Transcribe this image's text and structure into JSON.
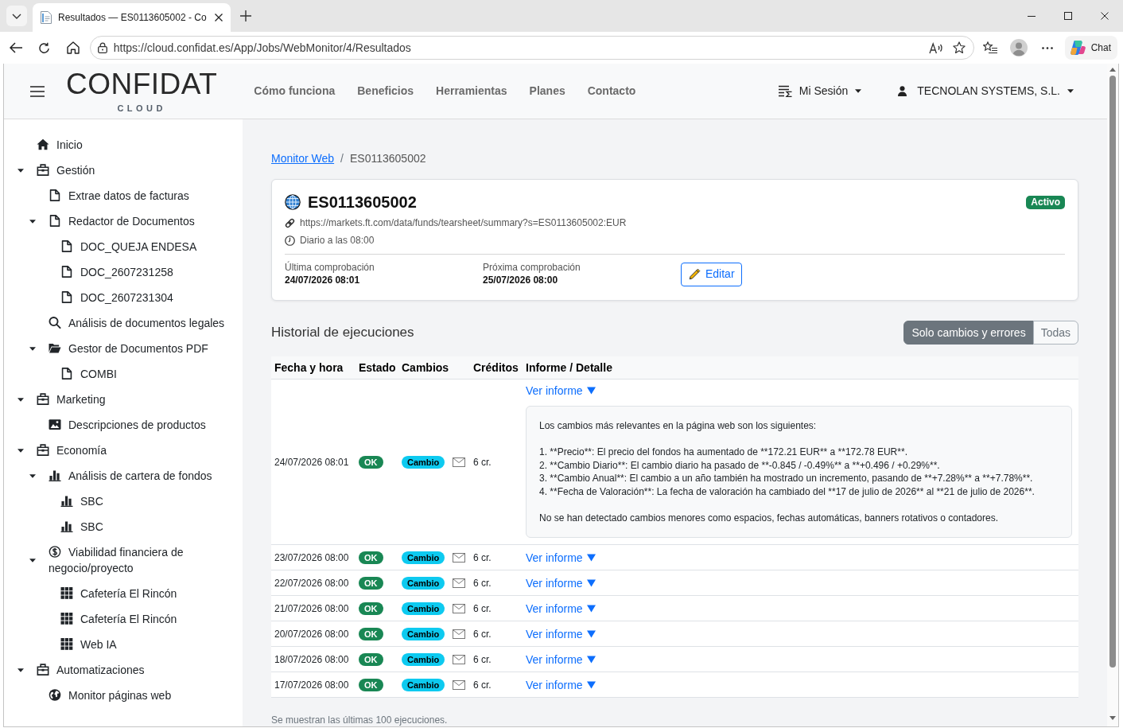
{
  "browser": {
    "tab_title": "Resultados — ES0113605002 - Co",
    "url": "https://cloud.confidat.es/App/Jobs/WebMonitor/4/Resultados",
    "chat_button": "Chat"
  },
  "navbar": {
    "logo": "CONFIDAT",
    "logo_subtitle": "CLOUD",
    "links": [
      "Cómo funciona",
      "Beneficios",
      "Herramientas",
      "Planes",
      "Contacto"
    ],
    "session_menu": "Mi Sesión",
    "account_menu": "TECNOLAN SYSTEMS, S.L."
  },
  "sidebar": {
    "items": [
      {
        "label": "Inicio",
        "kind": "home"
      },
      {
        "label": "Gestión",
        "kind": "toolbox",
        "expanded": true,
        "children": [
          {
            "label": "Extrae datos de facturas",
            "kind": "document"
          },
          {
            "label": "Redactor de Documentos",
            "kind": "document",
            "expanded": true,
            "children": [
              {
                "label": "DOC_QUEJA ENDESA",
                "kind": "document"
              },
              {
                "label": "DOC_2607231258",
                "kind": "document"
              },
              {
                "label": "DOC_2607231304",
                "kind": "document"
              }
            ]
          },
          {
            "label": "Análisis de documentos legales",
            "kind": "search"
          },
          {
            "label": "Gestor de Documentos PDF",
            "kind": "folder",
            "expanded": true,
            "children": [
              {
                "label": "COMBI",
                "kind": "document"
              }
            ]
          }
        ]
      },
      {
        "label": "Marketing",
        "kind": "toolbox",
        "expanded": true,
        "children": [
          {
            "label": "Descripciones de productos",
            "kind": "image"
          }
        ]
      },
      {
        "label": "Economía",
        "kind": "toolbox",
        "expanded": true,
        "children": [
          {
            "label": "Análisis de cartera de fondos",
            "kind": "chart",
            "expanded": true,
            "children": [
              {
                "label": "SBC",
                "kind": "chart"
              },
              {
                "label": "SBC",
                "kind": "chart"
              }
            ]
          },
          {
            "label": "Viabilidad financiera de negocio/proyecto",
            "kind": "dollar",
            "expanded": true,
            "children": [
              {
                "label": "Cafetería El Rincón",
                "kind": "grid"
              },
              {
                "label": "Cafetería El Rincón",
                "kind": "grid"
              },
              {
                "label": "Web IA",
                "kind": "grid"
              }
            ]
          }
        ]
      },
      {
        "label": "Automatizaciones",
        "kind": "toolbox",
        "expanded": true,
        "children": [
          {
            "label": "Monitor páginas web",
            "kind": "globe"
          }
        ]
      }
    ]
  },
  "breadcrumb": {
    "parent": "Monitor Web",
    "separator": "/",
    "current": "ES0113605002"
  },
  "monitor": {
    "title": "ES0113605002",
    "status": "Activo",
    "url": "https://markets.ft.com/data/funds/tearsheet/summary?s=ES0113605002:EUR",
    "schedule": "Diario a las 08:00",
    "last_check_label": "Última comprobación",
    "last_check": "24/07/2026 08:01",
    "next_check_label": "Próxima comprobación",
    "next_check": "25/07/2026 08:00",
    "edit_button": "Editar"
  },
  "history": {
    "title": "Historial de ejecuciones",
    "filters": [
      {
        "label": "Solo cambios y errores",
        "selected": true
      },
      {
        "label": "Todas",
        "selected": false
      }
    ],
    "columns": [
      "Fecha y hora",
      "Estado",
      "Cambios",
      "Créditos",
      "Informe / Detalle"
    ],
    "rows": [
      {
        "date": "24/07/2026 08:01",
        "status": "OK",
        "change": "Cambio",
        "credits": "6 cr.",
        "link": "Ver informe",
        "report": {
          "intro": "Los cambios más relevantes en la página web son los siguientes:",
          "items": [
            "1. **Precio**: El precio del fondos ha aumentado de **172.21 EUR** a **172.78 EUR**.",
            "2. **Cambio Diario**: El cambio diario ha pasado de **-0.845 / -0.49%** a **+0.496 / +0.29%**.",
            "3. **Cambio Anual**: El cambio a un año también ha mostrado un incremento, pasando de **+7.28%** a **+7.78%**.",
            "4. **Fecha de Valoración**: La fecha de valoración ha cambiado del **17 de julio de 2026** al **21 de julio de 2026**."
          ],
          "note": "No se han detectado cambios menores como espacios, fechas automáticas, banners rotativos o contadores."
        }
      },
      {
        "date": "23/07/2026 08:00",
        "status": "OK",
        "change": "Cambio",
        "credits": "6 cr.",
        "link": "Ver informe"
      },
      {
        "date": "22/07/2026 08:00",
        "status": "OK",
        "change": "Cambio",
        "credits": "6 cr.",
        "link": "Ver informe"
      },
      {
        "date": "21/07/2026 08:00",
        "status": "OK",
        "change": "Cambio",
        "credits": "6 cr.",
        "link": "Ver informe"
      },
      {
        "date": "20/07/2026 08:00",
        "status": "OK",
        "change": "Cambio",
        "credits": "6 cr.",
        "link": "Ver informe"
      },
      {
        "date": "18/07/2026 08:00",
        "status": "OK",
        "change": "Cambio",
        "credits": "6 cr.",
        "link": "Ver informe"
      },
      {
        "date": "17/07/2026 08:00",
        "status": "OK",
        "change": "Cambio",
        "credits": "6 cr.",
        "link": "Ver informe"
      }
    ],
    "footer": "Se muestran las últimas 100 ejecuciones."
  }
}
